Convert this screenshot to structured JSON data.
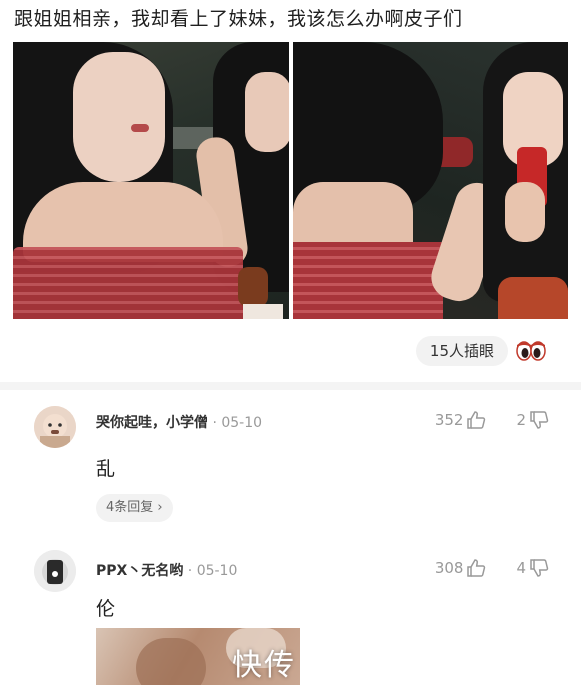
{
  "post": {
    "title": "跟姐姐相亲，我却看上了妹妹，我该怎么办啊皮子们",
    "watch_count_label": "15人插眼"
  },
  "comments": [
    {
      "user": "哭你起哇，小学僧",
      "date": "05-10",
      "likes": "352",
      "dislikes": "2",
      "text": "乱",
      "reply_label": "4条回复"
    },
    {
      "user": "PPX丶无名哟",
      "date": "05-10",
      "likes": "308",
      "dislikes": "4",
      "text": "伦"
    }
  ],
  "watermark": "快传",
  "icons": {
    "like": "thumbs-up-icon",
    "dislike": "thumbs-down-icon",
    "watch": "eyes-icon",
    "reply_more": "chevron-right-icon"
  },
  "colors": {
    "accent_red": "#c0392b",
    "muted_text": "#999999",
    "pill_bg": "#f2f2f2"
  }
}
